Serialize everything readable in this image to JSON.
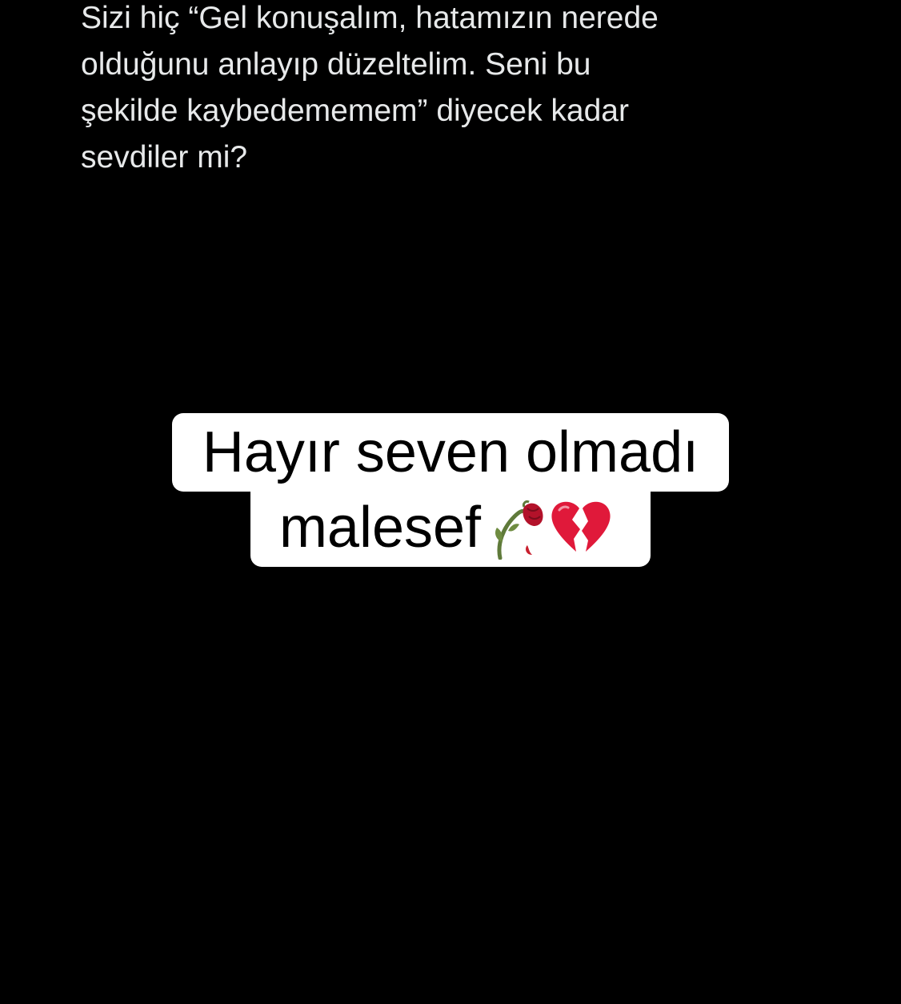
{
  "tweet": {
    "lines": [
      "Sizi hiç “Gel konuşalım, hatamızın nerede",
      "olduğunu anlayıp düzeltelim. Seni bu",
      "şekilde kaybedememem” diyecek kadar",
      "sevdiler mi?"
    ]
  },
  "caption": {
    "line1": "Hayır seven olmadı",
    "line2": "malesef",
    "emojis": [
      "wilted-flower-icon",
      "broken-heart-icon"
    ]
  },
  "colors": {
    "background": "#000000",
    "tweet_text": "#e7e9ea",
    "caption_bg": "#ffffff",
    "caption_text": "#000000",
    "heart": "#e0193a",
    "rose": "#b3122a",
    "stem": "#5f7a3a"
  }
}
